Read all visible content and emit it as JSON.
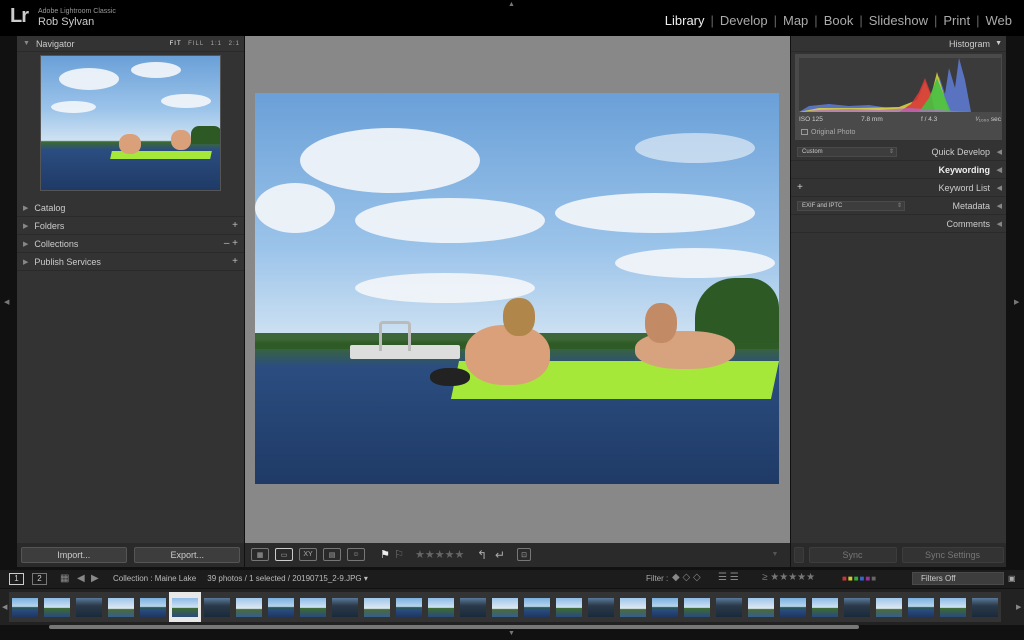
{
  "app": {
    "logo": "Lr",
    "product": "Adobe Lightroom Classic",
    "user": "Rob Sylvan"
  },
  "modules": [
    "Library",
    "Develop",
    "Map",
    "Book",
    "Slideshow",
    "Print",
    "Web"
  ],
  "active_module": "Library",
  "left_panel": {
    "navigator": {
      "title": "Navigator",
      "zoom_options": [
        "FIT",
        "FILL",
        "1:1",
        "2:1"
      ]
    },
    "sections": [
      {
        "label": "Catalog",
        "control": ""
      },
      {
        "label": "Folders",
        "control": "+"
      },
      {
        "label": "Collections",
        "control": "– +"
      },
      {
        "label": "Publish Services",
        "control": "+"
      }
    ],
    "import_label": "Import...",
    "export_label": "Export..."
  },
  "right_panel": {
    "histogram_title": "Histogram",
    "histogram_info": {
      "iso": "ISO 125",
      "focal": "7.8 mm",
      "aperture": "f / 4.3",
      "shutter": "¹⁄₁₀₀₀ sec"
    },
    "original_photo_label": "Original Photo",
    "quick_develop_preset": "Custom",
    "sections": [
      "Quick Develop",
      "Keywording",
      "Keyword List",
      "Metadata",
      "Comments"
    ],
    "metadata_preset": "EXIF and IPTC",
    "sync_label": "Sync",
    "sync_settings_label": "Sync Settings"
  },
  "filmstrip": {
    "pages": [
      "1",
      "2"
    ],
    "collection": "Collection : Maine Lake",
    "count": "39 photos / 1 selected /",
    "filename": "20190715_2-9.JPG",
    "filter_label": "Filter :",
    "filters_off": "Filters Off",
    "thumb_count": 31,
    "selected_index": 5
  },
  "colors": {
    "accent": "#eeeeee",
    "mat": "#a6e83a",
    "panel": "#333333"
  }
}
